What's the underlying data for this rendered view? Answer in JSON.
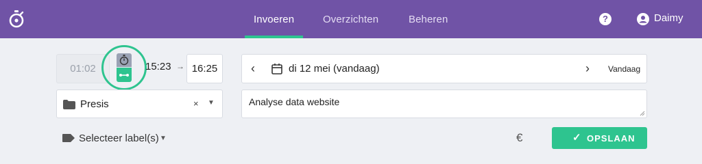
{
  "nav": {
    "tabs": [
      {
        "label": "Invoeren",
        "active": true
      },
      {
        "label": "Overzichten",
        "active": false
      },
      {
        "label": "Beheren",
        "active": false
      }
    ],
    "user_name": "Daimy",
    "help_icon": "question-circle-icon",
    "user_icon": "user-circle-icon"
  },
  "entry": {
    "duration": "01:02",
    "start_time": "15:23",
    "end_time": "16:25",
    "mode_icons": [
      "stopwatch-icon",
      "time-range-icon"
    ],
    "date": {
      "label": "di 12 mei (vandaag)",
      "today_button": "Vandaag"
    },
    "project": "Presis",
    "description": "Analyse data website",
    "labels_placeholder": "Selecteer label(s)",
    "save_label": "OPSLAAN"
  },
  "colors": {
    "brand_purple": "#7053a6",
    "accent_green": "#2ec48f"
  }
}
